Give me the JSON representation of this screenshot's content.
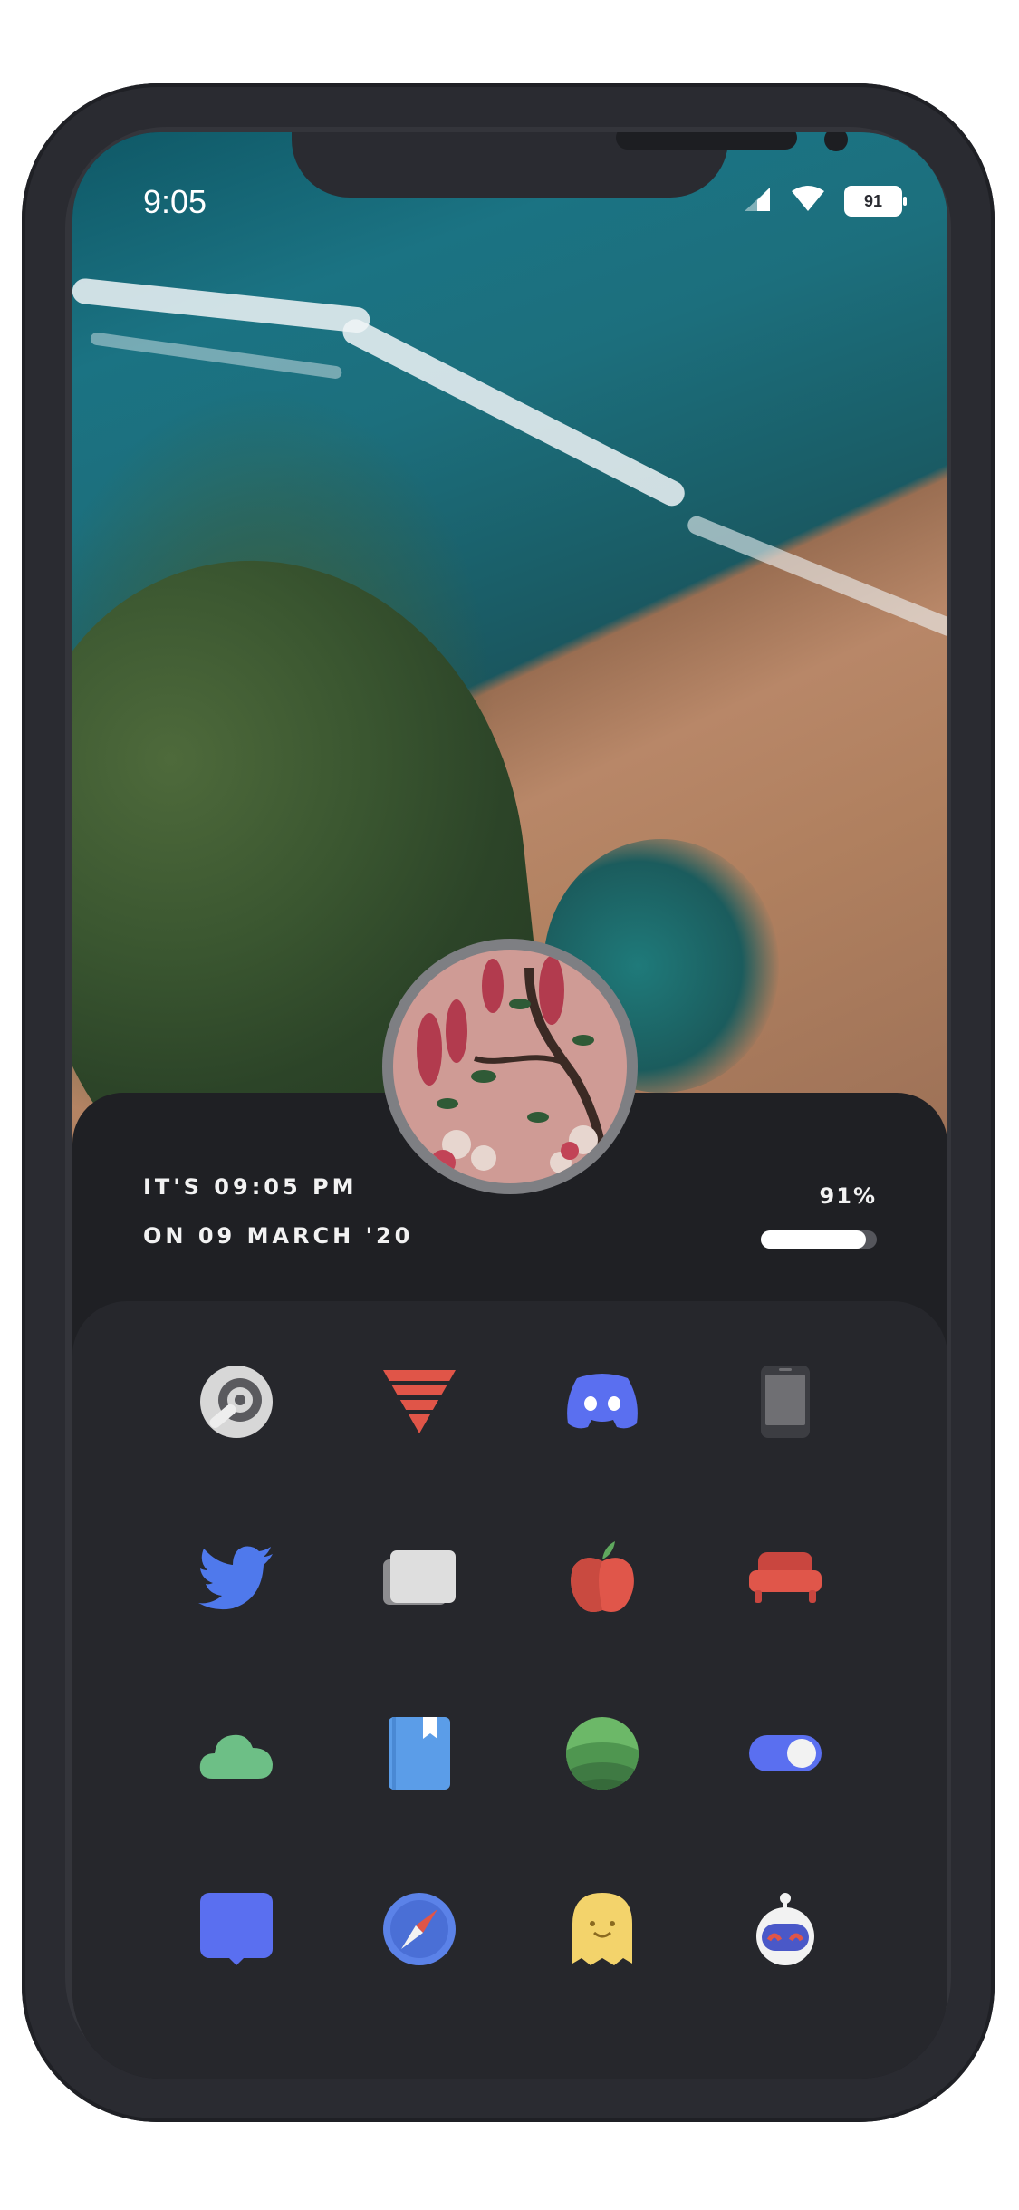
{
  "status_bar": {
    "time": "9:05",
    "battery_level": "91"
  },
  "widget": {
    "time_line": "IT'S 09:05 PM",
    "date_line": "ON 09 MARCH '20",
    "battery_percent": "91%",
    "battery_fraction": 0.91
  },
  "apps": [
    {
      "icon": "disk-icon"
    },
    {
      "icon": "layered-triangle-icon"
    },
    {
      "icon": "discord-icon"
    },
    {
      "icon": "phone-icon"
    },
    {
      "icon": "twitter-icon"
    },
    {
      "icon": "cards-icon"
    },
    {
      "icon": "apple-icon"
    },
    {
      "icon": "sofa-icon"
    },
    {
      "icon": "cloud-icon"
    },
    {
      "icon": "book-icon"
    },
    {
      "icon": "green-sphere-icon"
    },
    {
      "icon": "toggle-icon"
    },
    {
      "icon": "chat-bubble-icon"
    },
    {
      "icon": "compass-icon"
    },
    {
      "icon": "ghost-icon"
    },
    {
      "icon": "reddit-robot-icon"
    }
  ],
  "colors": {
    "frame": "#2a2b31",
    "panel": "#1f2024",
    "grid_panel": "#26272c"
  }
}
